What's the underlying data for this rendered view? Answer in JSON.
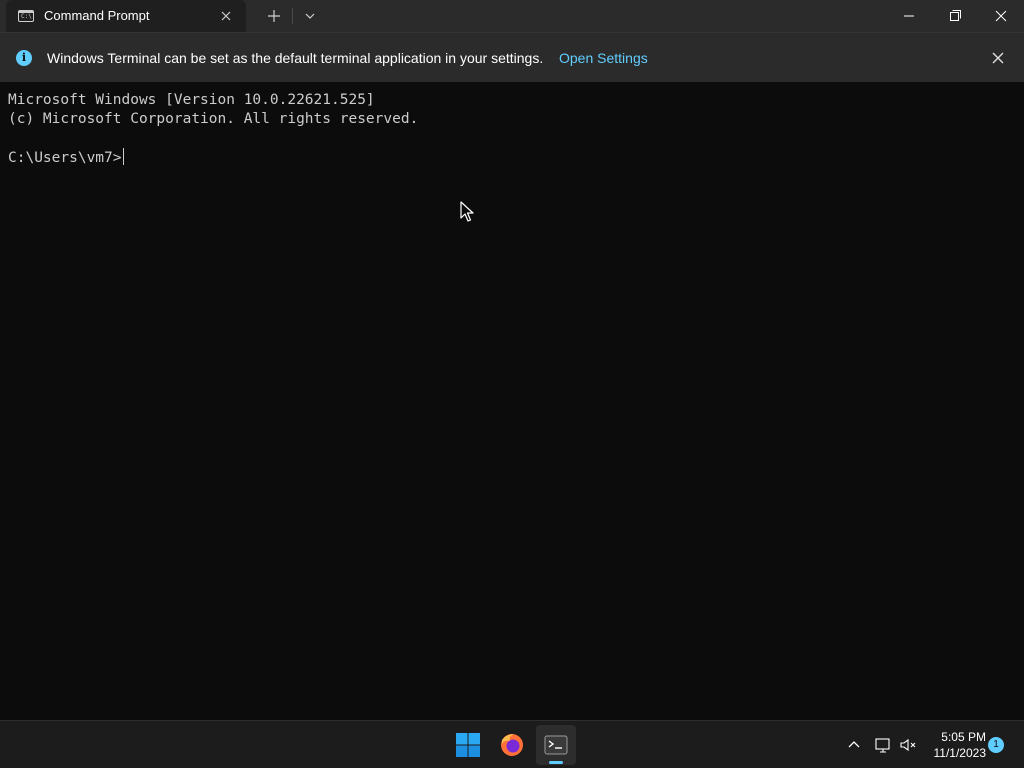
{
  "window": {
    "tab_title": "Command Prompt",
    "tab_icon": "cmd-icon",
    "tab_icon_glyph": "C:\\"
  },
  "infobar": {
    "message": "Windows Terminal can be set as the default terminal application in your settings.",
    "link": "Open Settings"
  },
  "terminal": {
    "lines": [
      "Microsoft Windows [Version 10.0.22621.525]",
      "(c) Microsoft Corporation. All rights reserved.",
      "",
      "C:\\Users\\vm7>"
    ]
  },
  "taskbar": {
    "apps": [
      "start-icon",
      "firefox-icon",
      "terminal-icon"
    ],
    "time": "5:05 PM",
    "date": "11/1/2023",
    "notification_count": "1"
  },
  "colors": {
    "accent": "#60cdff",
    "terminal_bg": "#0c0c0c",
    "terminal_fg": "#cccccc"
  }
}
